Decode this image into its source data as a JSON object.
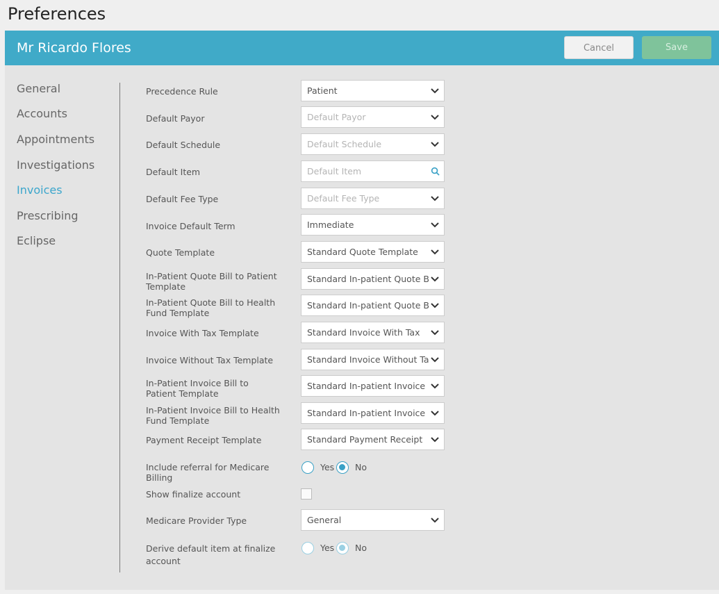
{
  "page": {
    "title": "Preferences"
  },
  "header": {
    "patient_name": "Mr Ricardo Flores",
    "cancel_label": "Cancel",
    "save_label": "Save"
  },
  "nav": {
    "items": [
      "General",
      "Accounts",
      "Appointments",
      "Investigations",
      "Invoices",
      "Prescribing",
      "Eclipse"
    ],
    "active": "Invoices"
  },
  "form": {
    "precedence_rule": {
      "label": "Precedence Rule",
      "value": "Patient"
    },
    "default_payor": {
      "label": "Default Payor",
      "placeholder": "Default Payor"
    },
    "default_schedule": {
      "label": "Default Schedule",
      "placeholder": "Default Schedule"
    },
    "default_item": {
      "label": "Default Item",
      "placeholder": "Default Item"
    },
    "default_fee_type": {
      "label": "Default Fee Type",
      "placeholder": "Default Fee Type"
    },
    "invoice_default_term": {
      "label": "Invoice Default Term",
      "value": "Immediate"
    },
    "quote_template": {
      "label": "Quote Template",
      "value": "Standard Quote Template"
    },
    "inpatient_quote_patient": {
      "label": "In-Patient Quote Bill to Patient Template",
      "value": "Standard In-patient Quote Bill"
    },
    "inpatient_quote_fund": {
      "label": "In-Patient Quote Bill to Health Fund Template",
      "value": "Standard In-patient Quote Bill"
    },
    "invoice_with_tax": {
      "label": "Invoice With Tax Template",
      "value": "Standard Invoice With Tax"
    },
    "invoice_without_tax": {
      "label": "Invoice Without Tax Template",
      "value": "Standard Invoice Without Tax"
    },
    "inpatient_invoice_patient": {
      "label": "In-Patient Invoice Bill to Patient Template",
      "value": "Standard In-patient Invoice"
    },
    "inpatient_invoice_fund": {
      "label": "In-Patient Invoice Bill to Health Fund Template",
      "value": "Standard In-patient Invoice"
    },
    "payment_receipt": {
      "label": "Payment Receipt Template",
      "value": "Standard Payment Receipt"
    },
    "include_referral": {
      "label": "Include referral for Medicare Billing",
      "yes": "Yes",
      "no": "No",
      "selected": "No"
    },
    "show_finalize": {
      "label": "Show finalize account",
      "checked": false
    },
    "medicare_provider_type": {
      "label": "Medicare Provider Type",
      "value": "General"
    },
    "derive_default_item": {
      "label": "Derive default item at finalize account",
      "yes": "Yes",
      "no": "No",
      "selected": "No",
      "disabled": true
    }
  },
  "colors": {
    "accent": "#40aac8",
    "save": "#7fc39b",
    "active_nav": "#3ba6cc"
  },
  "icons": {
    "dropdown": "chevron-down-icon",
    "search": "search-icon"
  }
}
